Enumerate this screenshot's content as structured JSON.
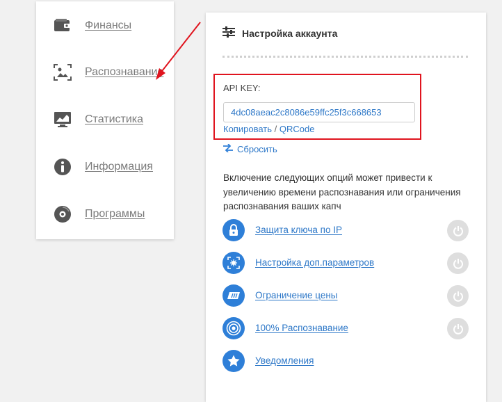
{
  "sidebar": {
    "items": [
      {
        "label": "Финансы",
        "icon": "wallet-icon"
      },
      {
        "label": "Распознавание",
        "icon": "image-scan-icon"
      },
      {
        "label": "Статистика",
        "icon": "monitor-chart-icon"
      },
      {
        "label": "Информация",
        "icon": "info-icon"
      },
      {
        "label": "Программы",
        "icon": "disc-icon"
      }
    ]
  },
  "panel": {
    "title": "Настройка аккаунта",
    "title_icon": "sliders-icon",
    "api_key_label": "API KEY:",
    "api_key_value": "4dc08aeac2c8086e59ffc25f3c668653",
    "copy_label": "Копировать",
    "separator": " / ",
    "qrcode_label": "QRCode",
    "reset_label": "Сбросить",
    "reset_icon": "swap-arrows-icon",
    "note": "Включение следующих опций может привести к увеличению времени распознавания или ограничения распознавания ваших капч",
    "options": [
      {
        "label": "Защита ключа по IP",
        "icon": "lock-icon",
        "toggle": true
      },
      {
        "label": "Настройка доп.параметров",
        "icon": "focus-icon",
        "toggle": true
      },
      {
        "label": "Ограничение цены",
        "icon": "price-tag-icon",
        "toggle": true
      },
      {
        "label": "100% Распознавание",
        "icon": "target-icon",
        "toggle": true
      },
      {
        "label": "Уведомления",
        "icon": "star-icon",
        "toggle": false
      }
    ]
  },
  "colors": {
    "accent": "#2e7fd8",
    "highlight": "#e0141e",
    "toggle_off": "#dedede"
  }
}
